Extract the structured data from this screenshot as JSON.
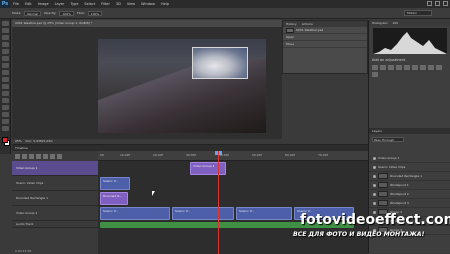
{
  "menubar": {
    "logo": "Ps",
    "items": [
      "File",
      "Edit",
      "Image",
      "Layer",
      "Type",
      "Select",
      "Filter",
      "3D",
      "View",
      "Window",
      "Help"
    ]
  },
  "options": {
    "mode_label": "Mode:",
    "mode_value": "Normal",
    "opacity_label": "Opacity:",
    "opacity_value": "100%",
    "flow_label": "Flow:",
    "flow_value": "100%",
    "workspace": "Motion"
  },
  "document": {
    "tab_title": "0001 Weather.psd @ 25% (Video Group 1, RGB/8) *",
    "zoom": "25%",
    "doc_info": "Doc: 5.93M/1.03G"
  },
  "mid_panel": {
    "tabs": [
      "History",
      "Actions"
    ],
    "rows": [
      "0001 Weather.psd",
      "Open",
      "Move"
    ]
  },
  "right_panel": {
    "tabs": [
      "Histogram",
      "Info"
    ],
    "adjust_tabs": [
      "Adjustments",
      "Styles"
    ],
    "adjust_title": "Add an adjustment",
    "layers_tabs": [
      "Layers",
      "Channels",
      "Paths"
    ],
    "blend": "Pass Through",
    "opacity": "100%",
    "layers": [
      "Video Group 1",
      "Scenic Video Clips",
      "Rounded Rectangle 1",
      "Windspout 1",
      "Windspout 2",
      "Windspout 3",
      "Group 1",
      "Group 2",
      "Group 3"
    ]
  },
  "timeline": {
    "title": "Timeline",
    "ruler": [
      "00",
      "10:00f",
      "20:00f",
      "30:00f",
      "40:00f",
      "50:00f",
      "60:00f",
      "70:00f"
    ],
    "tracks": [
      "Video Group 1",
      "Scenic Video Clips",
      "Rounded Rectangle 1",
      "Video Group 1",
      "Audio Track"
    ],
    "clips": {
      "c1": "Video Group 1",
      "c2": "Scenic V...",
      "c3": "Rounded R...",
      "c4": "Scenic V...",
      "c5": "Scenic V...",
      "c6": "Scenic V...",
      "c7": "Scenic V..."
    },
    "time": "0;00;15;00"
  },
  "watermark": {
    "main": "fotovideoeffect.com",
    "sub": "ВСЕ ДЛЯ ФОТО И ВИДЕО МОНТАЖА!"
  }
}
